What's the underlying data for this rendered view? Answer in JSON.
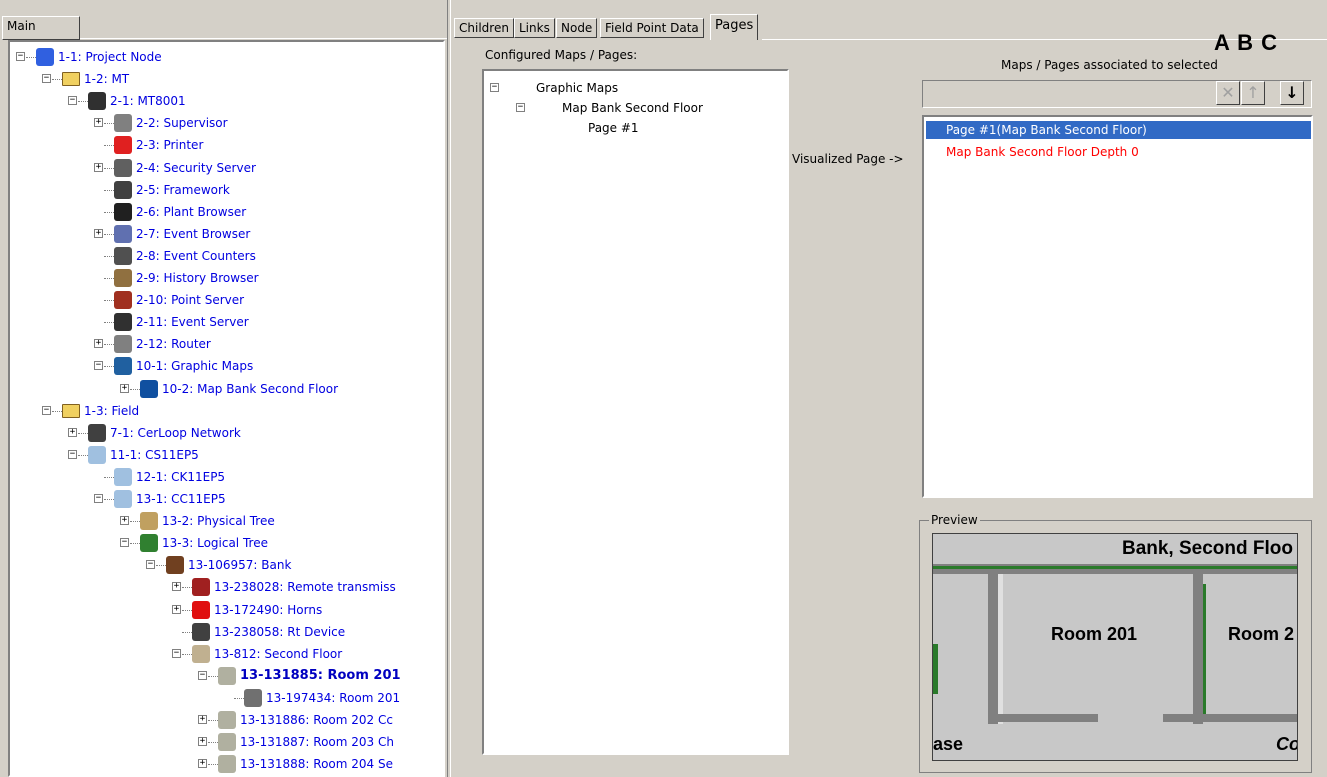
{
  "left_tab": "Main",
  "tree": [
    {
      "id": "n1",
      "depth": 0,
      "exp": "-",
      "icon": "project-node-icon",
      "label": "1-1: Project Node",
      "style": "normal"
    },
    {
      "id": "n2",
      "depth": 1,
      "exp": "-",
      "icon": "folder-icon",
      "label": "1-2: MT",
      "style": "normal"
    },
    {
      "id": "n3",
      "depth": 2,
      "exp": "-",
      "icon": "device-icon",
      "label": "2-1: MT8001",
      "style": "normal"
    },
    {
      "id": "n4",
      "depth": 3,
      "exp": "+",
      "icon": "supervisor-icon",
      "label": "2-2: Supervisor",
      "style": "normal"
    },
    {
      "id": "n5",
      "depth": 3,
      "exp": "",
      "icon": "printer-icon",
      "label": "2-3: Printer",
      "style": "normal"
    },
    {
      "id": "n6",
      "depth": 3,
      "exp": "+",
      "icon": "security-server-icon",
      "label": "2-4: Security Server",
      "style": "normal"
    },
    {
      "id": "n7",
      "depth": 3,
      "exp": "",
      "icon": "framework-icon",
      "label": "2-5: Framework",
      "style": "normal"
    },
    {
      "id": "n8",
      "depth": 3,
      "exp": "",
      "icon": "plant-browser-icon",
      "label": "2-6: Plant Browser",
      "style": "normal"
    },
    {
      "id": "n9",
      "depth": 3,
      "exp": "+",
      "icon": "event-browser-icon",
      "label": "2-7: Event Browser",
      "style": "normal"
    },
    {
      "id": "n10",
      "depth": 3,
      "exp": "",
      "icon": "event-counters-icon",
      "label": "2-8: Event Counters",
      "style": "normal"
    },
    {
      "id": "n11",
      "depth": 3,
      "exp": "",
      "icon": "history-browser-icon",
      "label": "2-9: History Browser",
      "style": "normal"
    },
    {
      "id": "n12",
      "depth": 3,
      "exp": "",
      "icon": "point-server-icon",
      "label": "2-10: Point Server",
      "style": "normal"
    },
    {
      "id": "n13",
      "depth": 3,
      "exp": "",
      "icon": "event-server-icon",
      "label": "2-11: Event Server",
      "style": "normal"
    },
    {
      "id": "n14",
      "depth": 3,
      "exp": "+",
      "icon": "router-icon",
      "label": "2-12: Router",
      "style": "normal"
    },
    {
      "id": "n15",
      "depth": 3,
      "exp": "-",
      "icon": "graphic-maps-icon",
      "label": "10-1: Graphic Maps",
      "style": "normal"
    },
    {
      "id": "n16",
      "depth": 4,
      "exp": "+",
      "icon": "map-icon",
      "label": "10-2: Map Bank Second Floor",
      "style": "normal"
    },
    {
      "id": "n17",
      "depth": 1,
      "exp": "-",
      "icon": "folder-icon",
      "label": "1-3: Field",
      "style": "normal"
    },
    {
      "id": "n18",
      "depth": 2,
      "exp": "+",
      "icon": "network-icon",
      "label": "7-1: CerLoop Network",
      "style": "normal"
    },
    {
      "id": "n19",
      "depth": 2,
      "exp": "-",
      "icon": "cs11-icon",
      "label": "11-1: CS11EP5",
      "style": "normal"
    },
    {
      "id": "n20",
      "depth": 3,
      "exp": "",
      "icon": "ck11-icon",
      "label": "12-1: CK11EP5",
      "style": "normal"
    },
    {
      "id": "n21",
      "depth": 3,
      "exp": "-",
      "icon": "cc11-icon",
      "label": "13-1: CC11EP5",
      "style": "normal"
    },
    {
      "id": "n22",
      "depth": 4,
      "exp": "+",
      "icon": "physical-tree-icon",
      "label": "13-2: Physical Tree",
      "style": "normal"
    },
    {
      "id": "n23",
      "depth": 4,
      "exp": "-",
      "icon": "logical-tree-icon",
      "label": "13-3: Logical Tree",
      "style": "normal"
    },
    {
      "id": "n24",
      "depth": 5,
      "exp": "-",
      "icon": "house-icon",
      "label": "13-106957: Bank",
      "style": "normal"
    },
    {
      "id": "n25",
      "depth": 6,
      "exp": "+",
      "icon": "remote-transmission-icon",
      "label": "13-238028: Remote transmiss",
      "style": "normal"
    },
    {
      "id": "n26",
      "depth": 6,
      "exp": "+",
      "icon": "horns-icon",
      "label": "13-172490: Horns",
      "style": "normal"
    },
    {
      "id": "n27",
      "depth": 6,
      "exp": "",
      "icon": "rt-device-icon",
      "label": "13-238058: Rt Device",
      "style": "normal"
    },
    {
      "id": "n28",
      "depth": 6,
      "exp": "-",
      "icon": "floor-icon",
      "label": "13-812: Second Floor",
      "style": "normal"
    },
    {
      "id": "n29",
      "depth": 7,
      "exp": "-",
      "icon": "room-icon",
      "label": "13-131885: Room 201",
      "style": "bold"
    },
    {
      "id": "n30",
      "depth": 8,
      "exp": "",
      "icon": "detector-icon",
      "label": "13-197434: Room 201",
      "style": "normal"
    },
    {
      "id": "n31",
      "depth": 7,
      "exp": "+",
      "icon": "room-icon",
      "label": "13-131886: Room 202  Cc",
      "style": "normal"
    },
    {
      "id": "n32",
      "depth": 7,
      "exp": "+",
      "icon": "room-icon",
      "label": "13-131887: Room 203  Ch",
      "style": "normal"
    },
    {
      "id": "n33",
      "depth": 7,
      "exp": "+",
      "icon": "room-icon",
      "label": "13-131888: Room 204  Se",
      "style": "normal"
    }
  ],
  "tabs": [
    "Children",
    "Links",
    "Node",
    "Field Point Data",
    "Pages"
  ],
  "active_tab": "Pages",
  "annotation": "A B C",
  "configured_label": "Configured Maps / Pages:",
  "configured_tree": [
    {
      "depth": 0,
      "exp": "-",
      "label": "Graphic Maps"
    },
    {
      "depth": 1,
      "exp": "-",
      "label": "Map Bank Second Floor"
    },
    {
      "depth": 2,
      "exp": "",
      "label": "Page #1"
    }
  ],
  "visualized_label": "Visualized Page ->",
  "assoc_label": "Maps / Pages associated to selected",
  "assoc_items": [
    {
      "label": "Page #1(Map Bank Second Floor)",
      "selected": true,
      "color": "#000000"
    },
    {
      "label": "Map Bank Second Floor Depth 0",
      "selected": false,
      "color": "#ff0000"
    }
  ],
  "toolbar": {
    "delete": "✕",
    "up": "↑",
    "down": "↓"
  },
  "preview": {
    "group_label": "Preview",
    "title": "Bank, Second Floo",
    "room1": "Room 201",
    "room2": "Room 2",
    "bottom_left": "ase",
    "bottom_right": "Co"
  },
  "colors": {
    "selection": "#316ac5",
    "link_text": "#0000e0",
    "panel": "#d4d0c8"
  }
}
